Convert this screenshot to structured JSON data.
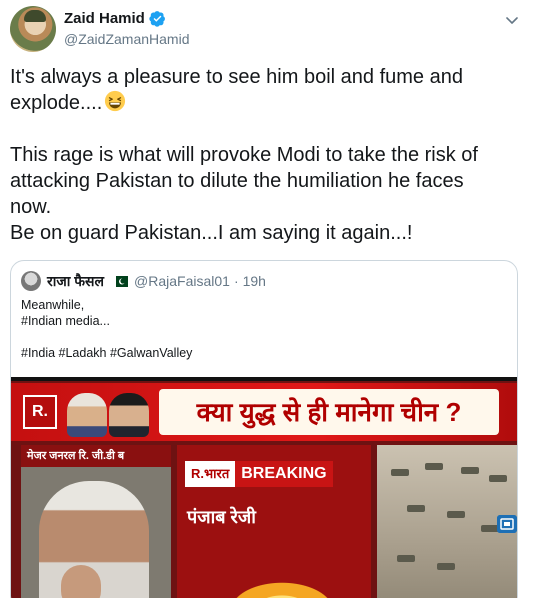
{
  "author": {
    "display_name": "Zaid Hamid",
    "handle": "@ZaidZamanHamid",
    "verified_icon": "verified-badge-icon"
  },
  "tweet": {
    "line1": "It's always a pleasure to see him boil and fume and",
    "line2": "explode....",
    "emoji": "grinning-squinting-face-emoji",
    "para2_line1": "This rage is what will provoke Modi to take the risk of",
    "para2_line2": "attacking Pakistan to dilute the humiliation he faces",
    "para2_line3": "now.",
    "para3": "Be on guard Pakistan...I am saying it again...!"
  },
  "quoted": {
    "display_name": "राजा फैसल",
    "handle": "@RajaFaisal01",
    "time": "19h",
    "separator": "·",
    "flag_icon": "pakistan-flag-icon",
    "text_line1": "Meanwhile,",
    "text_line2": "#Indian media...",
    "text_line3": "#India #Ladakh #GalwanValley"
  },
  "media": {
    "logo": "R.",
    "headline": "क्या युद्ध से ही मानेगा चीन ?",
    "left_caption": "मेजर जनरल रि. जी.डी ब",
    "brand": "R.भारत",
    "breaking_label": "BREAKING",
    "subtitle": "पंजाब रेजी"
  },
  "colors": {
    "text": "#14171a",
    "secondary": "#657786",
    "border": "#ccd6dd",
    "verified": "#1da1f2"
  }
}
